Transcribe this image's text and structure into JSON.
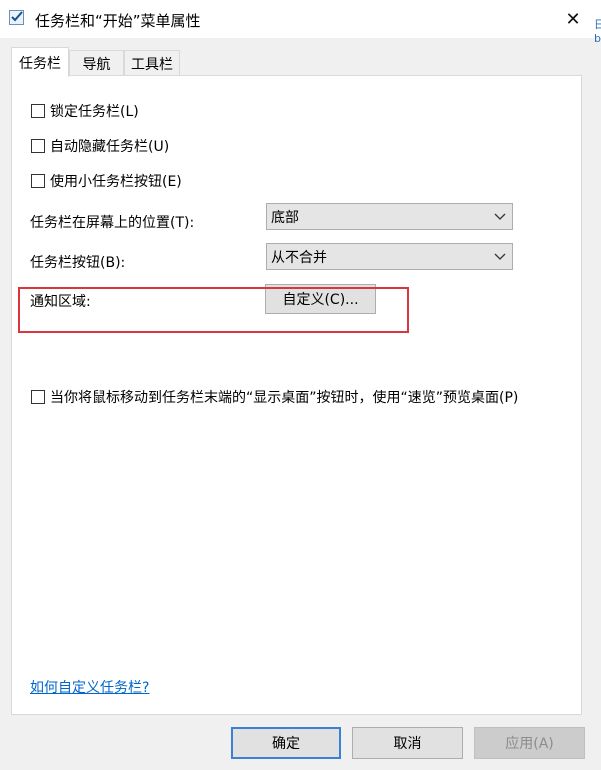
{
  "window": {
    "title": "任务栏和“开始”菜单属性",
    "close_glyph": "✕",
    "edge_text": "日 b"
  },
  "tabs": [
    {
      "label": "任务栏"
    },
    {
      "label": "导航"
    },
    {
      "label": "工具栏"
    }
  ],
  "options": {
    "lock": "锁定任务栏(L)",
    "autohide": "自动隐藏任务栏(U)",
    "small_buttons": "使用小任务栏按钮(E)"
  },
  "location": {
    "label": "任务栏在屏幕上的位置(T):",
    "value": "底部"
  },
  "buttons_combine": {
    "label": "任务栏按钮(B):",
    "value": "从不合并"
  },
  "notification": {
    "label": "通知区域:",
    "button": "自定义(C)..."
  },
  "peek_option": "当你将鼠标移动到任务栏末端的“显示桌面”按钮时，使用“速览”预览桌面(P)",
  "help_link": "如何自定义任务栏?",
  "footer": {
    "ok": "确定",
    "cancel": "取消",
    "apply": "应用(A)"
  },
  "colors": {
    "highlight": "#d9363e",
    "link": "#0066cc",
    "focus": "#3c7fd6"
  },
  "icons": {
    "dropdown": "chevron-down-icon",
    "app": "checkmark-window-icon",
    "close": "close-icon"
  }
}
